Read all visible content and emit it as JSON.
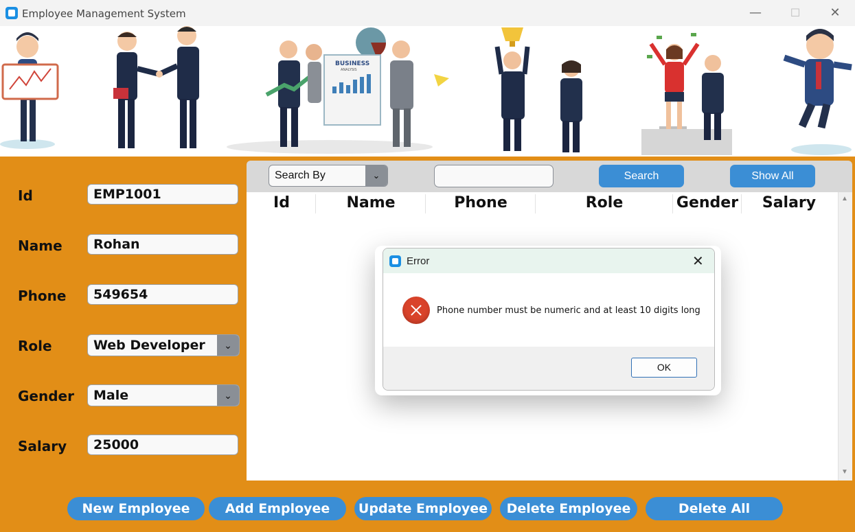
{
  "window": {
    "title": "Employee Management System",
    "minimize_glyph": "—",
    "maximize_glyph": "☐",
    "close_glyph": "✕"
  },
  "banner": {
    "board_text": "BUSINESS",
    "board_subtext": "ANALYSIS"
  },
  "form": {
    "id_label": "Id",
    "id_value": "EMP1001",
    "name_label": "Name",
    "name_value": "Rohan",
    "phone_label": "Phone",
    "phone_value": "549654",
    "role_label": "Role",
    "role_value": "Web Developer",
    "gender_label": "Gender",
    "gender_value": "Male",
    "salary_label": "Salary",
    "salary_value": "25000"
  },
  "search": {
    "search_by": "Search By",
    "query": "",
    "search_label": "Search",
    "show_all_label": "Show All"
  },
  "table": {
    "columns": [
      "Id",
      "Name",
      "Phone",
      "Role",
      "Gender",
      "Salary"
    ]
  },
  "actions": {
    "new": "New Employee",
    "add": "Add Employee",
    "update": "Update Employee",
    "delete": "Delete Employee",
    "delete_all": "Delete All"
  },
  "dialog": {
    "title": "Error",
    "message": "Phone number must be numeric and at least 10 digits long",
    "ok_label": "OK",
    "close_glyph": "✕"
  },
  "colors": {
    "background": "#e28e17",
    "button_blue": "#3b8ed5",
    "error_red": "#d9432a"
  },
  "icons": {
    "app": "app-window-icon",
    "dropdown": "chevron-down-icon",
    "error": "error-circle-x-icon"
  }
}
